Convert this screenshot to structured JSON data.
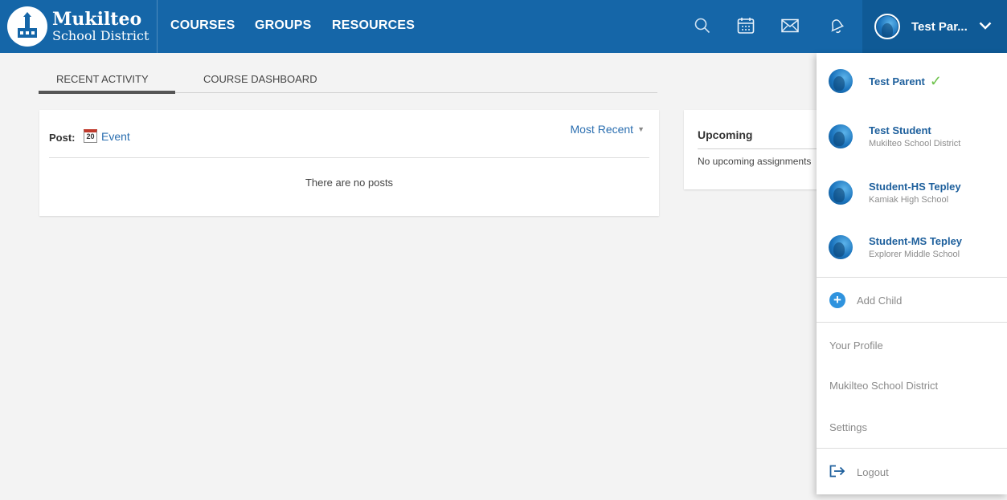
{
  "brand": {
    "name_line1": "Mukilteo",
    "name_line2": "School District"
  },
  "nav": {
    "links": [
      "COURSES",
      "GROUPS",
      "RESOURCES"
    ],
    "user_label": "Test Par..."
  },
  "tabs": {
    "recent_activity": "RECENT ACTIVITY",
    "course_dashboard": "COURSE DASHBOARD"
  },
  "feed": {
    "post_label": "Post:",
    "event_day": "20",
    "event_label": "Event",
    "sort_label": "Most Recent",
    "empty_text": "There are no posts"
  },
  "upcoming": {
    "title": "Upcoming",
    "empty_text": "No upcoming assignments"
  },
  "dropdown": {
    "accounts": [
      {
        "name": "Test Parent",
        "subtitle": "",
        "selected": true
      },
      {
        "name": "Test Student",
        "subtitle": "Mukilteo School District",
        "selected": false
      },
      {
        "name": "Student-HS Tepley",
        "subtitle": "Kamiak High School",
        "selected": false
      },
      {
        "name": "Student-MS Tepley",
        "subtitle": "Explorer Middle School",
        "selected": false
      }
    ],
    "add_child": "Add Child",
    "your_profile": "Your Profile",
    "district": "Mukilteo School District",
    "settings": "Settings",
    "logout": "Logout"
  },
  "colors": {
    "header_blue": "#1566a8",
    "link_blue": "#2a6eb0",
    "check_green": "#6cc24a"
  }
}
